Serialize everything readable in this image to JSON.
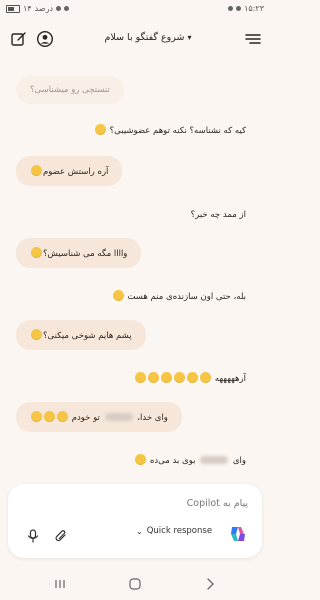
{
  "status": {
    "time": "۱۵:۲۳",
    "battery": "۱۴",
    "battery_suffix": "درصد"
  },
  "header": {
    "title": "شروع گفتگو با سلام"
  },
  "messages": [
    {
      "type": "bot",
      "text": "تنستچی رو میشناسی؟"
    },
    {
      "type": "user",
      "text": "کیه که نشناسه؟ نکنه توهم عضوشیبی؟"
    },
    {
      "type": "bot",
      "text": "آره راستش عضوم"
    },
    {
      "type": "user",
      "text": "از ممد چه خبر؟"
    },
    {
      "type": "bot",
      "text": "واااا مگه می شناسیش؟"
    },
    {
      "type": "user",
      "text": "بله، حتی اون سازنده‌ی منم هست"
    },
    {
      "type": "bot",
      "text": "پشم هایم شوخی میکنی؟"
    },
    {
      "type": "user",
      "text": "آرهههههه"
    },
    {
      "type": "bot",
      "text_a": "وای خدا،",
      "text_b": "تو خودم"
    },
    {
      "type": "user",
      "text_a": "وای",
      "text_b": "بوی بد می‌ده"
    }
  ],
  "composer": {
    "placeholder": "پیام به Copilot",
    "quick_response": "Quick response"
  },
  "colors": {
    "background": "#fbf6f1",
    "bubble": "#f6e7da",
    "emoji": "#f6c544"
  },
  "icons": [
    "menu-icon",
    "chevron-down-icon",
    "avatar-icon",
    "new-chat-icon",
    "mic-icon",
    "attach-icon",
    "copilot-logo",
    "recent-apps-icon",
    "home-icon",
    "back-icon"
  ]
}
